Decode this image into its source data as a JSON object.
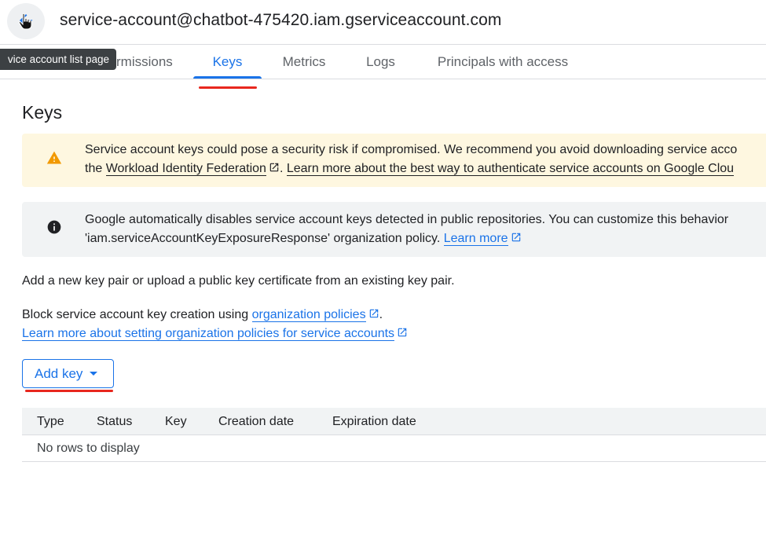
{
  "header": {
    "title": "service-account@chatbot-475420.iam.gserviceaccount.com",
    "back_icon": "arrow-back-icon"
  },
  "tooltip": {
    "text": "vice account list page"
  },
  "tabs": [
    {
      "label": "rmissions",
      "active": false
    },
    {
      "label": "Keys",
      "active": true
    },
    {
      "label": "Metrics",
      "active": false
    },
    {
      "label": "Logs",
      "active": false
    },
    {
      "label": "Principals with access",
      "active": false
    }
  ],
  "section_title": "Keys",
  "warning_banner": {
    "icon": "warning-icon",
    "line1": "Service account keys could pose a security risk if compromised. We recommend you avoid downloading service acco",
    "line2_prefix": "the ",
    "link1": "Workload Identity Federation",
    "middle": ". ",
    "link2": "Learn more about the best way to authenticate service accounts on Google Clou"
  },
  "info_banner": {
    "icon": "info-icon",
    "line1": "Google automatically disables service account keys detected in public repositories. You can customize this behavior",
    "line2_prefix": "'iam.serviceAccountKeyExposureResponse' organization policy. ",
    "link": "Learn more"
  },
  "intro_text": "Add a new key pair or upload a public key certificate from an existing key pair.",
  "block_text": {
    "prefix": "Block service account key creation using ",
    "link": "organization policies",
    "suffix": "."
  },
  "learn_more_policies": "Learn more about setting organization policies for service accounts",
  "add_key_button": {
    "label": "Add key",
    "icon": "dropdown-caret-icon"
  },
  "table": {
    "columns": [
      "Type",
      "Status",
      "Key",
      "Creation date",
      "Expiration date"
    ],
    "empty_text": "No rows to display"
  },
  "colors": {
    "accent": "#1a73e8",
    "warning": "#f29900",
    "annotation_red": "#e8271e"
  }
}
